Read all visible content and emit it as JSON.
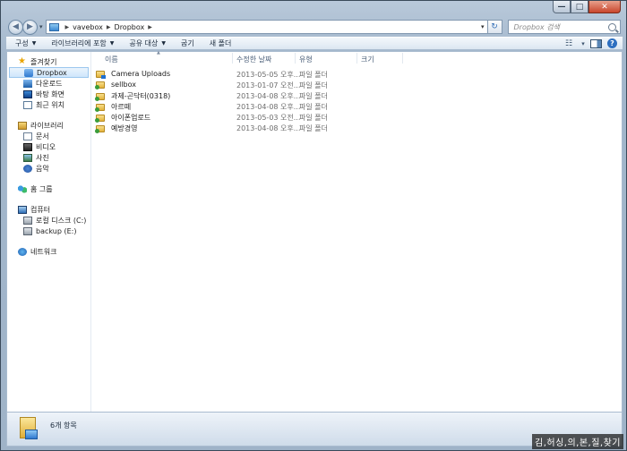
{
  "window": {
    "caption_buttons": {
      "minimize": "—",
      "maximize": "□",
      "close": "✕"
    }
  },
  "nav": {
    "back_glyph": "◀",
    "forward_glyph": "▶",
    "history_glyph": "▾",
    "breadcrumb": [
      "vavebox",
      "Dropbox"
    ],
    "search_placeholder": "Dropbox 검색"
  },
  "toolbar": {
    "items": [
      {
        "label": "구성",
        "dropdown": true
      },
      {
        "label": "라이브러리에 포함",
        "dropdown": true
      },
      {
        "label": "공유 대상",
        "dropdown": true
      },
      {
        "label": "굽기",
        "dropdown": false
      },
      {
        "label": "새 폴더",
        "dropdown": false
      }
    ],
    "view_glyph": "☷",
    "view_arrow": "▾",
    "help_glyph": "?"
  },
  "sidebar": {
    "favorites": {
      "label": "즐겨찾기",
      "items": [
        {
          "label": "Dropbox",
          "icon": "dropbox-icon"
        },
        {
          "label": "다운로드",
          "icon": "downloads-icon"
        },
        {
          "label": "바탕 화면",
          "icon": "desktop-icon"
        },
        {
          "label": "최근 위치",
          "icon": "recent-places-icon"
        }
      ]
    },
    "libraries": {
      "label": "라이브러리",
      "items": [
        {
          "label": "문서",
          "icon": "documents-icon"
        },
        {
          "label": "비디오",
          "icon": "videos-icon"
        },
        {
          "label": "사진",
          "icon": "pictures-icon"
        },
        {
          "label": "음악",
          "icon": "music-icon"
        }
      ]
    },
    "homegroup": {
      "label": "홈 그룹"
    },
    "computer": {
      "label": "컴퓨터",
      "items": [
        {
          "label": "로컬 디스크 (C:)",
          "icon": "local-disk-icon"
        },
        {
          "label": "backup (E:)",
          "icon": "backup-drive-icon"
        }
      ]
    },
    "network": {
      "label": "네트워크"
    }
  },
  "file_list": {
    "columns": [
      "이름",
      "수정한 날짜",
      "유형",
      "크기"
    ],
    "rows": [
      {
        "name": "Camera Uploads",
        "date": "2013-05-05 오후...",
        "type": "파일 폴더",
        "icon": "camera-folder-icon"
      },
      {
        "name": "sellbox",
        "date": "2013-01-07 오전...",
        "type": "파일 폴더",
        "icon": "shared-folder-icon"
      },
      {
        "name": "과제-곤닥터(0318)",
        "date": "2013-04-08 오후...",
        "type": "파일 폴더",
        "icon": "shared-folder-icon"
      },
      {
        "name": "아르떼",
        "date": "2013-04-08 오후...",
        "type": "파일 폴더",
        "icon": "shared-folder-icon"
      },
      {
        "name": "아이폰업로드",
        "date": "2013-05-03 오전...",
        "type": "파일 폴더",
        "icon": "shared-folder-icon"
      },
      {
        "name": "예방경영",
        "date": "2013-04-08 오후...",
        "type": "파일 폴더",
        "icon": "shared-folder-icon"
      }
    ]
  },
  "details": {
    "item_count": "6개 항목"
  },
  "watermark": "김,허싱,의,본,질,찾기"
}
